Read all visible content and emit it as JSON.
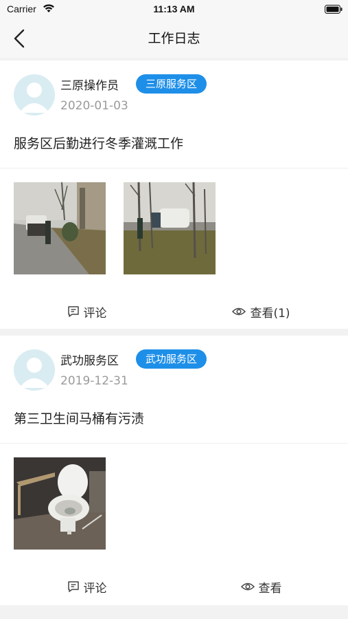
{
  "status_bar": {
    "carrier": "Carrier",
    "time": "11:13 AM"
  },
  "nav": {
    "title": "工作日志",
    "back_icon": "chevron-left-icon"
  },
  "posts": [
    {
      "author": "三原操作员",
      "area_badge": "三原服务区",
      "date": "2020-01-03",
      "content": "服务区后勤进行冬季灌溉工作",
      "photos": [
        "watering-truck-photo",
        "trees-watering-photo"
      ],
      "comment_label": "评论",
      "view_label": "查看(1)"
    },
    {
      "author": "武功服务区",
      "area_badge": "武功服务区",
      "date": "2019-12-31",
      "content": "第三卫生间马桶有污渍",
      "photos": [
        "toilet-photo"
      ],
      "comment_label": "评论",
      "view_label": "查看"
    }
  ],
  "colors": {
    "accent": "#1e8fe8",
    "background": "#f2f2f2",
    "date": "#9a9a9a"
  }
}
